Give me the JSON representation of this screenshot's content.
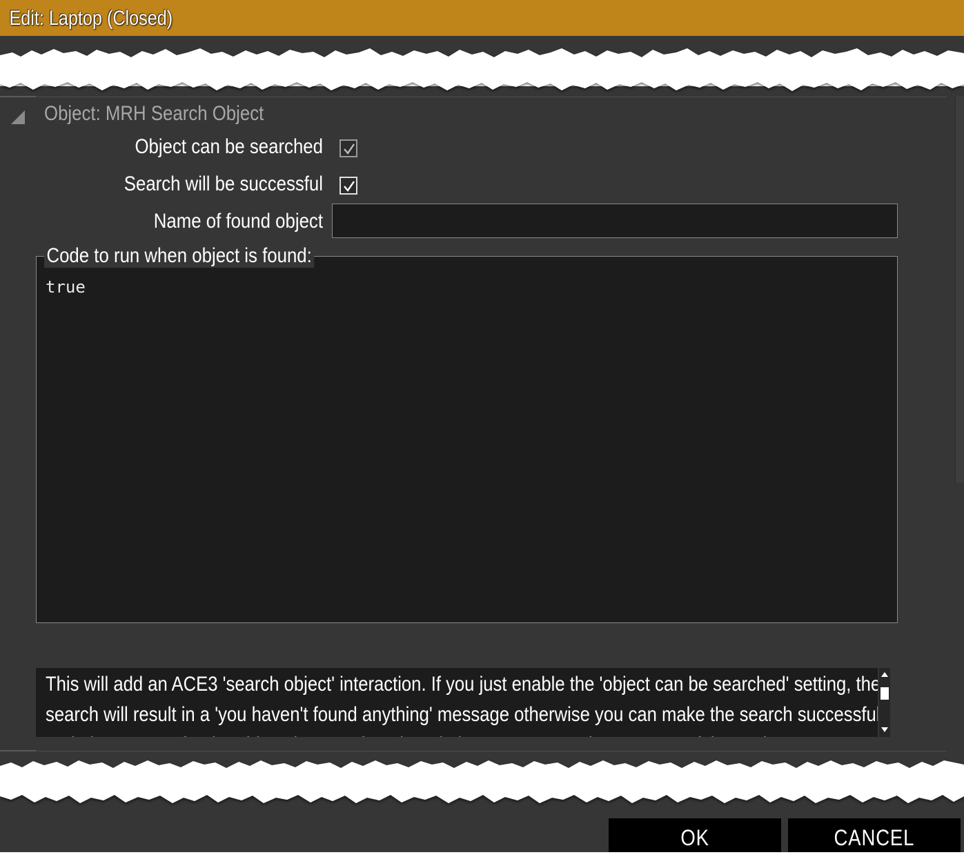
{
  "window": {
    "title": "Edit: Laptop (Closed)"
  },
  "section": {
    "title": "Object: MRH Search Object",
    "fields": {
      "can_search_label": "Object can be searched",
      "can_search_checked": true,
      "success_label": "Search will be successful",
      "success_checked": true,
      "found_name_label": "Name of found object",
      "found_name_value": "",
      "code_label": "Code to run when object is found:",
      "code_value": "true"
    },
    "description": "This will add an ACE3 'search object' interaction. If you just enable the 'object can be searched' setting, the search will result in a 'you haven't found anything' message otherwise you can make the search successful and give a name for the object that was found, and also run some code on successful search."
  },
  "buttons": {
    "ok_label": "OK",
    "cancel_label": "CANCEL"
  },
  "colors": {
    "titlebar": "#bf841a",
    "panel": "#363636",
    "field": "#1c1c1c"
  }
}
